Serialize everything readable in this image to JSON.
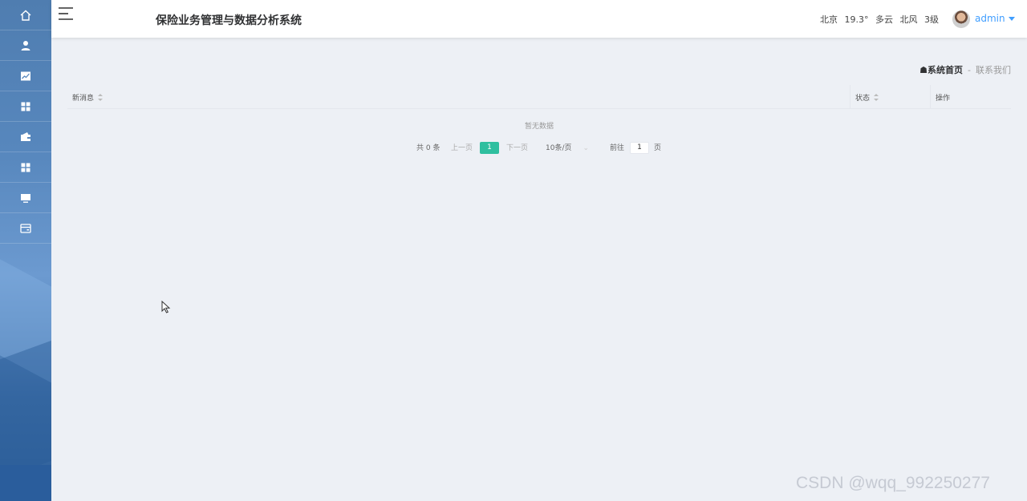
{
  "header": {
    "title": "保险业务管理与数据分析系统",
    "weather": {
      "city": "北京",
      "temp": "19.3°",
      "condition": "多云",
      "wind": "北风",
      "level": "3级"
    },
    "user": "admin"
  },
  "sidebar": {
    "items": [
      {
        "icon": "home-icon"
      },
      {
        "icon": "user-icon"
      },
      {
        "icon": "chart-icon"
      },
      {
        "icon": "grid-icon"
      },
      {
        "icon": "wallet-icon"
      },
      {
        "icon": "grid-icon"
      },
      {
        "icon": "monitor-icon"
      },
      {
        "icon": "card-icon"
      }
    ]
  },
  "breadcrumb": {
    "home": "系统首页",
    "separator": "-",
    "contact": "联系我们"
  },
  "table": {
    "columns": [
      "新消息",
      "状态",
      "操作"
    ],
    "empty_text": "暂无数据"
  },
  "pagination": {
    "total": "共 0 条",
    "prev": "上一页",
    "current": "1",
    "next": "下一页",
    "page_size": "10条/页",
    "goto": "前往",
    "goto_value": "1",
    "page_unit": "页"
  },
  "watermark": "CSDN @wqq_992250277",
  "colors": {
    "accent": "#2fbf9f",
    "link": "#409eff",
    "sidebar": "#5787bd"
  }
}
